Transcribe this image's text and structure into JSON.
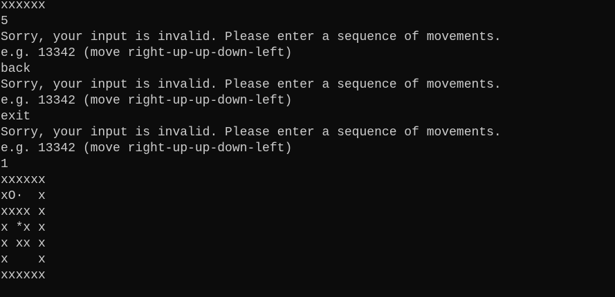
{
  "console": {
    "lines": [
      "xxxxxx",
      "5",
      "Sorry, your input is invalid. Please enter a sequence of movements.",
      "e.g. 13342 (move right-up-up-down-left)",
      "back",
      "Sorry, your input is invalid. Please enter a sequence of movements.",
      "e.g. 13342 (move right-up-up-down-left)",
      "exit",
      "Sorry, your input is invalid. Please enter a sequence of movements.",
      "e.g. 13342 (move right-up-up-down-left)",
      "1",
      "xxxxxx",
      "xO·  x",
      "xxxx x",
      "x *x x",
      "x xx x",
      "x    x",
      "xxxxxx"
    ]
  }
}
